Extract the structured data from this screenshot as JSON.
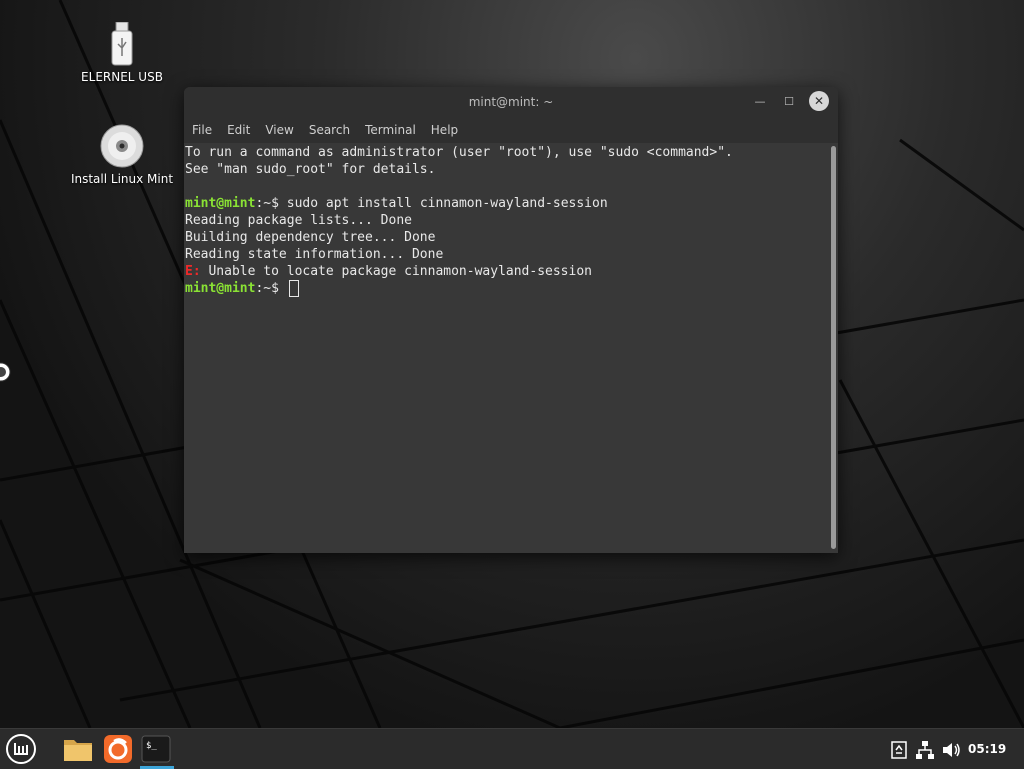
{
  "desktop": {
    "icons": [
      {
        "label": "ELERNEL USB"
      },
      {
        "label": "Install Linux Mint"
      }
    ]
  },
  "window": {
    "title": "mint@mint: ~",
    "menu": [
      "File",
      "Edit",
      "View",
      "Search",
      "Terminal",
      "Help"
    ]
  },
  "terminal": {
    "intro1": "To run a command as administrator (user \"root\"), use \"sudo <command>\".",
    "intro2": "See \"man sudo_root\" for details.",
    "prompt_user": "mint@mint",
    "prompt_path": ":~$ ",
    "command": "sudo apt install cinnamon-wayland-session",
    "out1": "Reading package lists... Done",
    "out2": "Building dependency tree... Done",
    "out3": "Reading state information... Done",
    "error_tag": "E:",
    "error_msg": " Unable to locate package cinnamon-wayland-session"
  },
  "taskbar": {
    "clock": "05:19",
    "icons": [
      "mint-menu-icon",
      "files-icon",
      "firefox-icon",
      "terminal-icon",
      "show-desktop-icon",
      "network-icon",
      "volume-icon"
    ]
  },
  "colors": {
    "prompt": "#8ae234",
    "error": "#ef2929",
    "terminal_bg": "#383838",
    "titlebar_bg": "#2f2f2f",
    "taskbar_bg": "#2b2b2b"
  }
}
